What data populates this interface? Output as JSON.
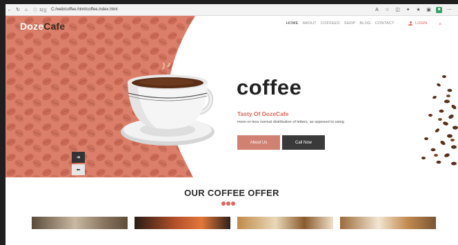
{
  "browser": {
    "address_label": "파일",
    "url": "C:/web/coffee.html/coffee.index.html"
  },
  "header": {
    "logo_part1": "Doze",
    "logo_part2": "Cafe",
    "menu": [
      "HOME",
      "ABOUT",
      "COFFEES",
      "SHOP",
      "BLOG",
      "CONTACT"
    ],
    "login_label": "LOGIN"
  },
  "hero": {
    "title": "coffee",
    "tagline": "Tasty Of DozeCafe",
    "description": "more-or-less normal distribution of letters, as opposed to using",
    "about_button": "About Us",
    "call_button": "Call Now",
    "next_arrow": "➜",
    "prev_arrow": "⬅"
  },
  "offer": {
    "title": "OUR COFFEE OFFER"
  },
  "colors": {
    "accent": "#d9685a",
    "button_secondary": "#3a3a3a",
    "bean_bg": "#d9755f"
  }
}
